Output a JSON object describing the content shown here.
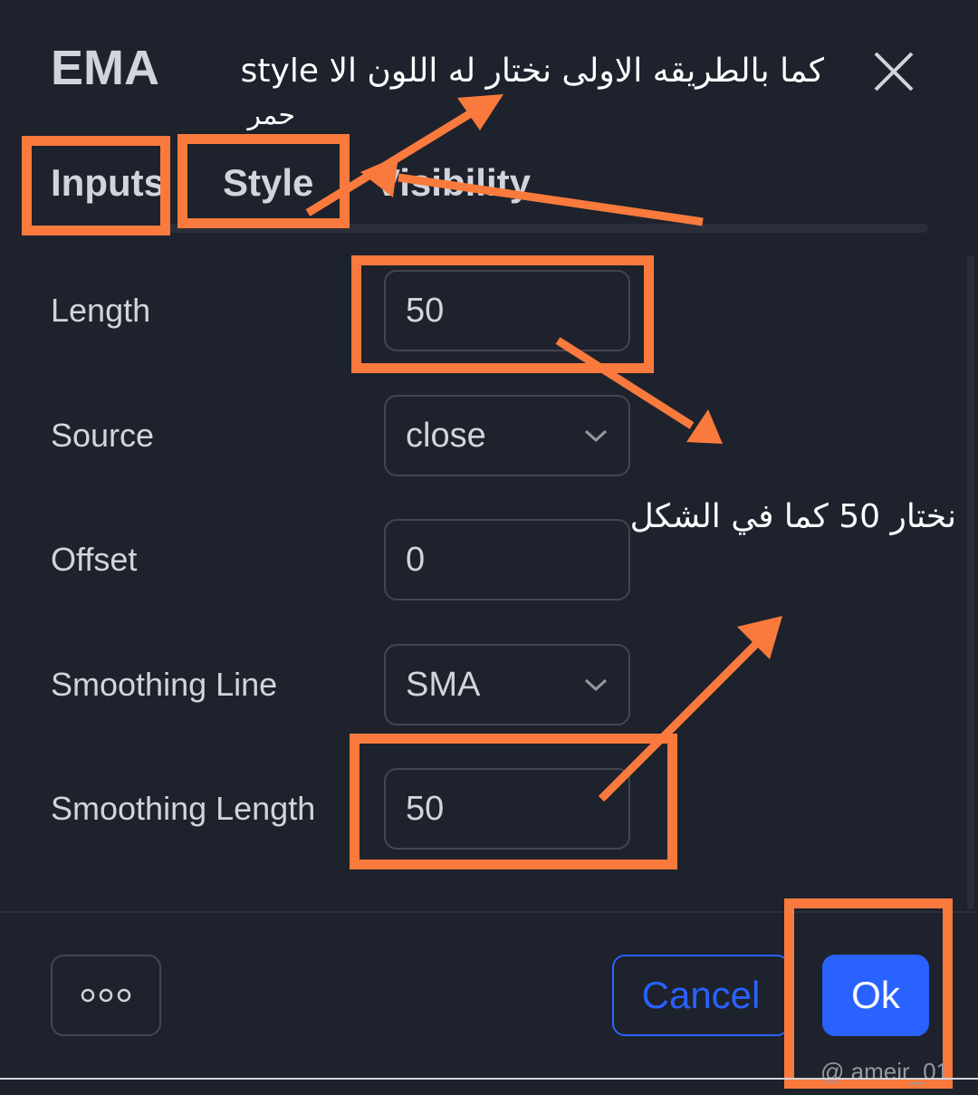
{
  "dialog": {
    "title": "EMA",
    "tabs": [
      {
        "label": "Inputs"
      },
      {
        "label": "Style"
      },
      {
        "label": "Visibility"
      }
    ]
  },
  "inputs": {
    "length": {
      "label": "Length",
      "value": "50"
    },
    "source": {
      "label": "Source",
      "value": "close"
    },
    "offset": {
      "label": "Offset",
      "value": "0"
    },
    "smoothing_line": {
      "label": "Smoothing Line",
      "value": "SMA"
    },
    "smoothing_length": {
      "label": "Smoothing Length",
      "value": "50"
    }
  },
  "footer": {
    "cancel_label": "Cancel",
    "ok_label": "Ok"
  },
  "annotations": {
    "note_top_line1": "كما بالطريقه الاولى نختار له اللون الا style",
    "note_top_line2": "حمر",
    "note_middle": "نختار 50 كما في الشكل",
    "highlight_color": "#f97a3c"
  },
  "watermark": "@ ameir_01",
  "colors": {
    "background": "#1e222d",
    "text": "#d1d4dc",
    "accent": "#2962ff",
    "border": "#434651"
  }
}
